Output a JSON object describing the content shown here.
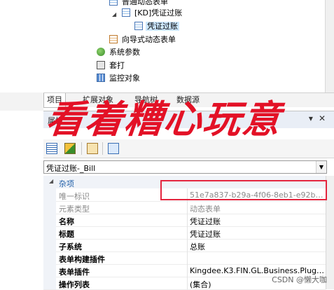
{
  "tree": {
    "nodes": [
      {
        "label": "普通动态表单",
        "icon": "form-icon"
      },
      {
        "label": "[KD]凭证过账",
        "icon": "form-icon"
      },
      {
        "label": "凭证过账",
        "icon": "form-icon"
      },
      {
        "label": "向导式动态表单",
        "icon": "wizard-form-icon"
      },
      {
        "label": "系统参数",
        "icon": "parameter-icon"
      },
      {
        "label": "套打",
        "icon": "print-template-icon"
      },
      {
        "label": "监控对象",
        "icon": "monitor-object-icon"
      }
    ]
  },
  "tabs": [
    "项目",
    "扩展对象",
    "导航树",
    "数据源"
  ],
  "overlay_text": "看着糟心玩意",
  "panel": {
    "title": "属性"
  },
  "object_selector": {
    "value": "凭证过账-_Bill"
  },
  "grid": {
    "category": "杂项",
    "rows": [
      {
        "name": "唯一标识",
        "value": "51e7a837-b29a-4f06-8eb1-e92b…"
      },
      {
        "name": "元素类型",
        "value": "动态表单"
      },
      {
        "name": "名称",
        "value": "凭证过账"
      },
      {
        "name": "标题",
        "value": "凭证过账"
      },
      {
        "name": "子系统",
        "value": "总账"
      },
      {
        "name": "表单构建插件",
        "value": ""
      },
      {
        "name": "表单插件",
        "value": "Kingdee.K3.FIN.GL.Business.Plug…"
      },
      {
        "name": "操作列表",
        "value": "(集合)"
      }
    ]
  },
  "watermark": "CSDN @懒大咖",
  "colors": {
    "highlight": "#e4263f",
    "selection": "#cde8ff",
    "category": "#1f5fa8"
  }
}
